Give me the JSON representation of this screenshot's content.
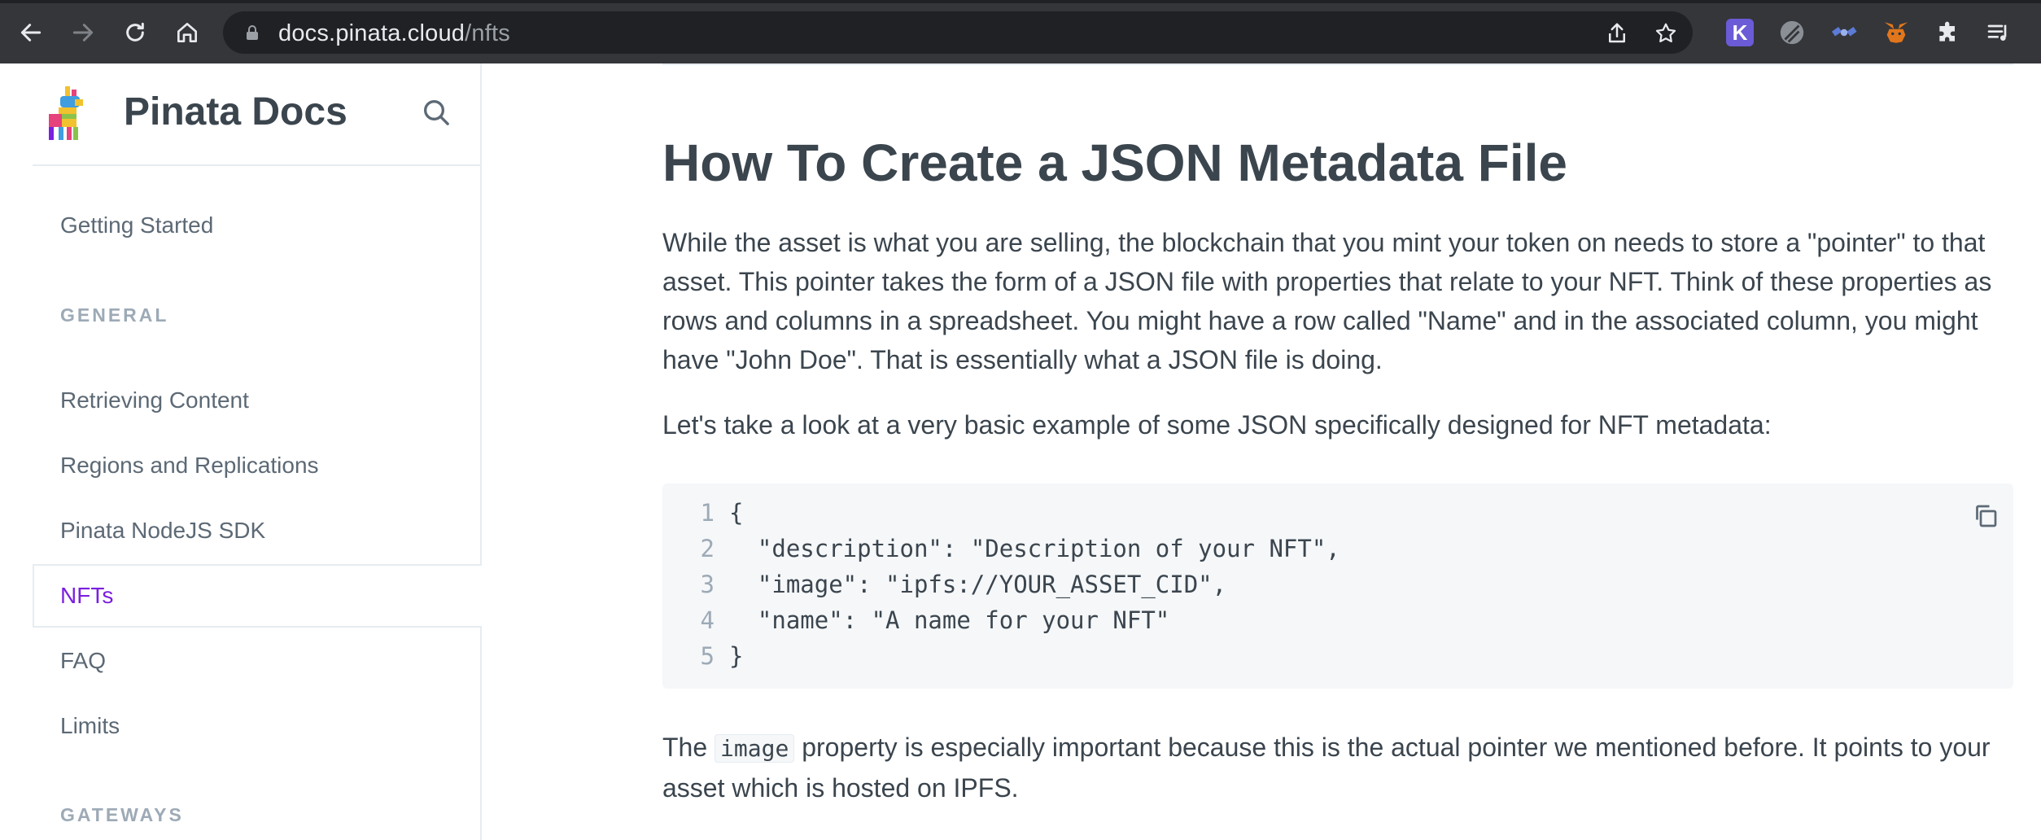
{
  "browser": {
    "url_host": "docs.pinata.cloud",
    "url_path": "/nfts",
    "extensions": [
      {
        "name": "k-extension-icon",
        "letter": "K",
        "color": "#6b5bd6"
      },
      {
        "name": "globe-extension-icon",
        "color": "#9aa0a6"
      },
      {
        "name": "satellite-extension-icon",
        "color": "#5b7bd6"
      },
      {
        "name": "metamask-fox-icon",
        "color": "#e2761b"
      },
      {
        "name": "puzzle-extensions-icon",
        "color": "#e8eaed"
      },
      {
        "name": "reading-list-icon",
        "color": "#e8eaed"
      }
    ]
  },
  "sidebar": {
    "title": "Pinata Docs",
    "items": [
      {
        "label": "Getting Started"
      },
      {
        "label": "Retrieving Content"
      },
      {
        "label": "Regions and Replications"
      },
      {
        "label": "Pinata NodeJS SDK"
      },
      {
        "label": "NFTs",
        "active": true
      },
      {
        "label": "FAQ"
      },
      {
        "label": "Limits"
      }
    ],
    "groups": [
      "GENERAL",
      "GATEWAYS"
    ]
  },
  "main": {
    "title": "How To Create a JSON Metadata File",
    "para1": "While the asset is what you are selling, the blockchain that you mint your token on needs to store a \"pointer\" to that asset. This pointer takes the form of a JSON file with properties that relate to your NFT. Think of these properties as rows and columns in a spreadsheet. You might have a row called \"Name\" and in the associated column, you might have \"John Doe\". That is essentially what a JSON file is doing.",
    "para2": "Let's take a look at a very basic example of some JSON specifically designed for NFT metadata:",
    "code": {
      "line_numbers": [
        "1",
        "2",
        "3",
        "4",
        "5"
      ],
      "lines": [
        "{",
        "  \"description\": \"Description of your NFT\",",
        "  \"image\": \"ipfs://YOUR_ASSET_CID\",",
        "  \"name\": \"A name for your NFT\"",
        "}"
      ]
    },
    "para3_before": "The",
    "para3_code": "image",
    "para3_after": "property is especially important because this is the actual pointer we mentioned before. It points to your asset which is hosted on IPFS."
  },
  "colors": {
    "accent": "#7b1fe0",
    "text": "#3b454e",
    "muted": "#5c6975",
    "chrome": "#35363a"
  }
}
